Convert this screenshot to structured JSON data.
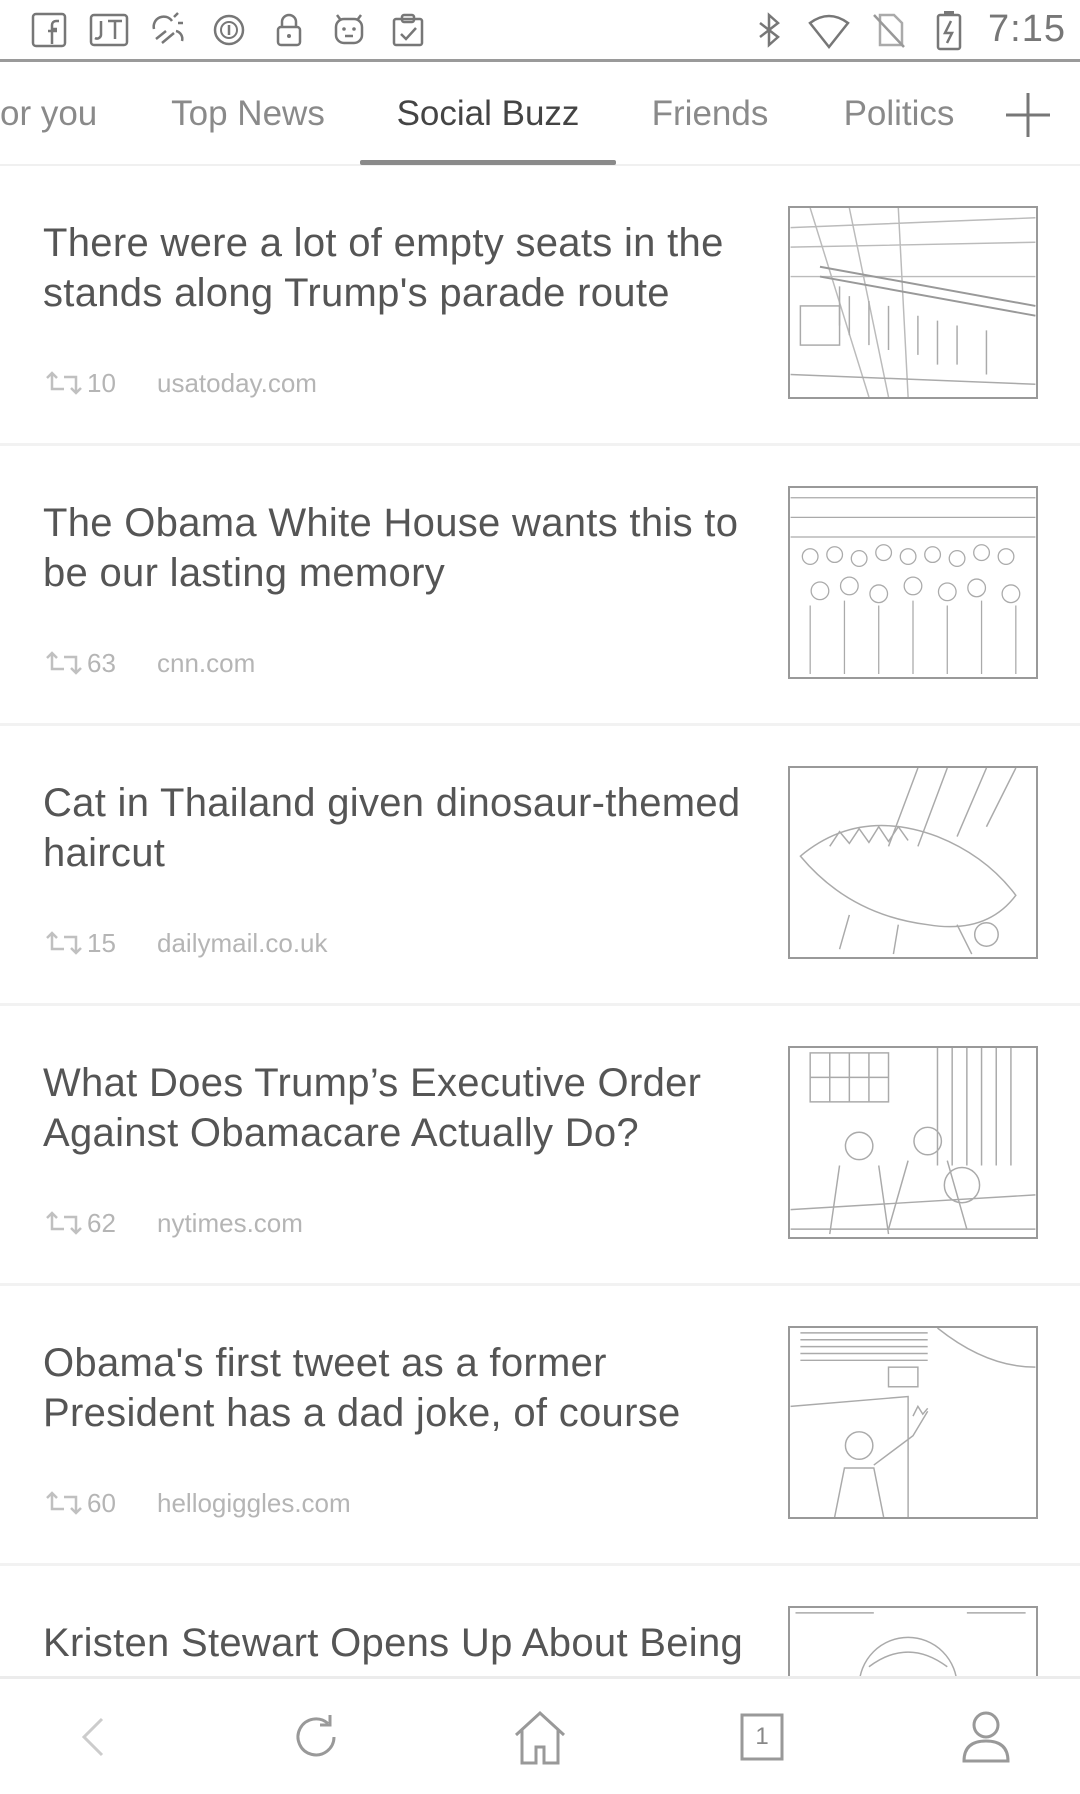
{
  "status_bar": {
    "time": "7:15",
    "left_icons": [
      "facebook-icon",
      "jt-icon",
      "weather-icon",
      "circle-icon",
      "lock-icon",
      "android-icon",
      "clipboard-icon"
    ],
    "right_icons": [
      "bluetooth-icon",
      "wifi-icon",
      "no-sim-icon",
      "battery-charging-icon"
    ]
  },
  "tabs": [
    {
      "label": "or you",
      "active": false
    },
    {
      "label": "Top News",
      "active": false
    },
    {
      "label": "Social Buzz",
      "active": true
    },
    {
      "label": "Friends",
      "active": false
    },
    {
      "label": "Politics",
      "active": false
    }
  ],
  "articles": [
    {
      "headline": "There were a lot of empty seats in the stands along Trump's parade route",
      "shares": "10",
      "source": "usatoday.com",
      "thumbnail": "parade-image"
    },
    {
      "headline": "The Obama White House wants this to be our lasting memory",
      "shares": "63",
      "source": "cnn.com",
      "thumbnail": "crowd-image"
    },
    {
      "headline": "Cat in Thailand given dinosaur-themed haircut",
      "shares": "15",
      "source": "dailymail.co.uk",
      "thumbnail": "cat-image"
    },
    {
      "headline": "What Does Trump’s Executive Order Against Obamacare Actually Do?",
      "shares": "62",
      "source": "nytimes.com",
      "thumbnail": "oval-office-image"
    },
    {
      "headline": "Obama's first tweet as a former President has a dad joke, of course",
      "shares": "60",
      "source": "hellogiggles.com",
      "thumbnail": "obama-waving-image"
    },
    {
      "headline": "Kristen Stewart Opens Up About Being Shamed by President Donald J",
      "shares": "",
      "source": "",
      "thumbnail": "kristen-image"
    }
  ],
  "bottom_nav": {
    "tab_count": "1",
    "icons": [
      "back-icon",
      "refresh-icon",
      "home-icon",
      "tabs-icon",
      "profile-icon"
    ]
  }
}
